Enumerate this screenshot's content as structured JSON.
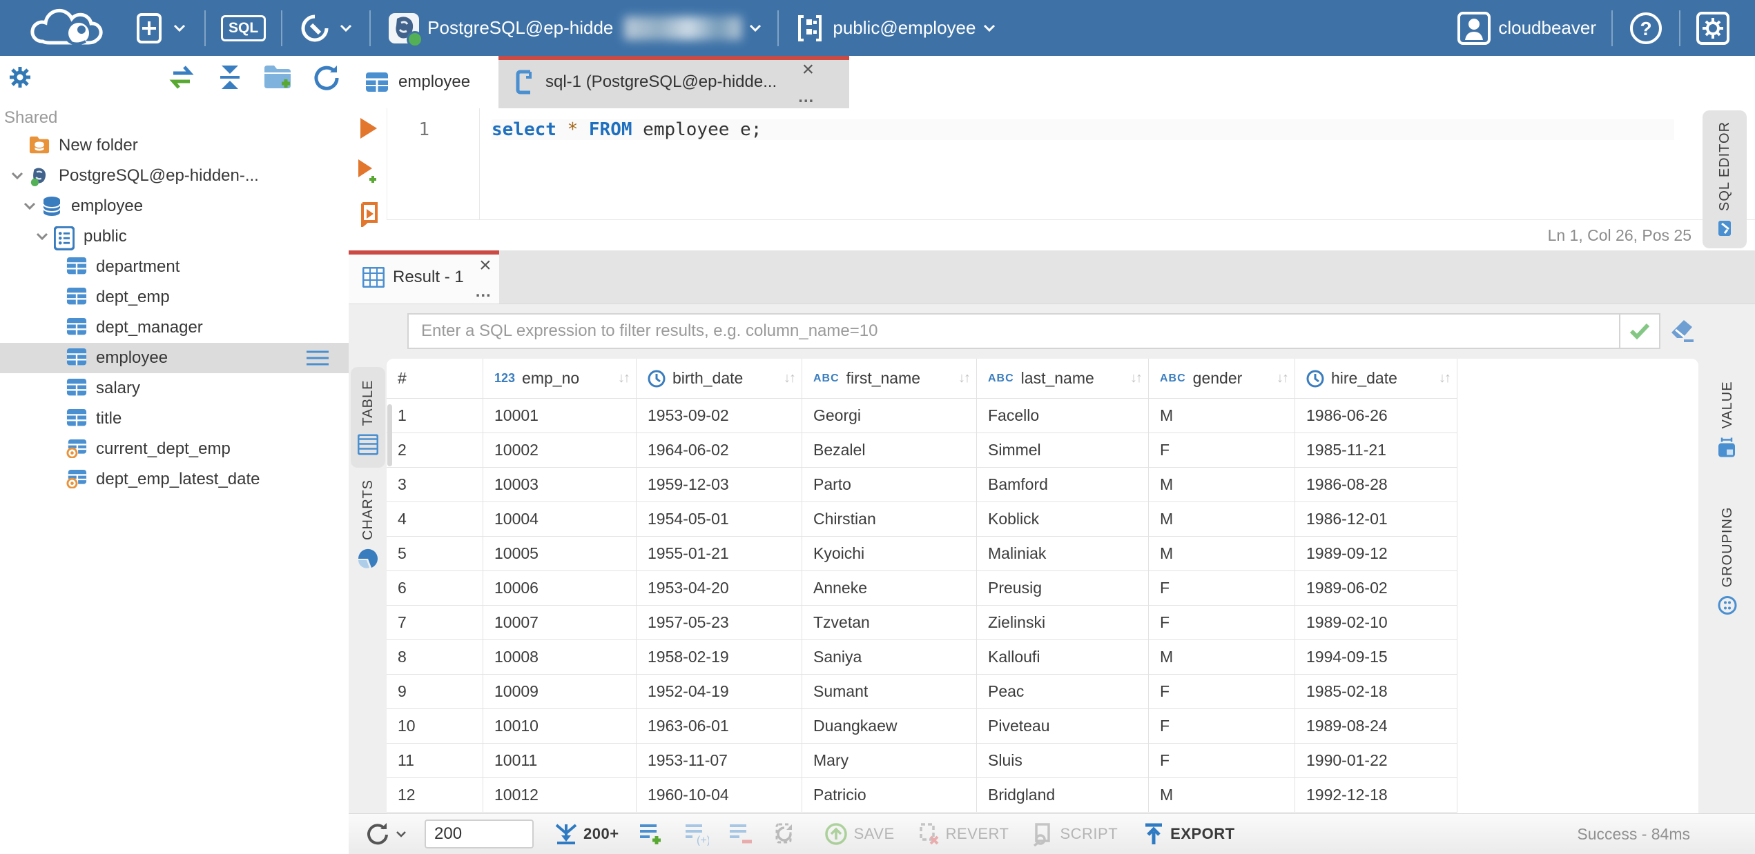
{
  "topbar": {
    "sql_button": "SQL",
    "connection_label": "PostgreSQL@ep-hidde",
    "schema_label": "public@employee",
    "user_label": "cloudbeaver"
  },
  "sidebar": {
    "section_label": "Shared",
    "tree": [
      {
        "label": "New folder",
        "icon": "folder-db",
        "depth": 0,
        "chevron": false
      },
      {
        "label": "PostgreSQL@ep-hidden-...",
        "icon": "postgres",
        "depth": 0,
        "chevron": true
      },
      {
        "label": "employee",
        "icon": "database",
        "depth": 1,
        "chevron": true
      },
      {
        "label": "public",
        "icon": "schema",
        "depth": 2,
        "chevron": true
      },
      {
        "label": "department",
        "icon": "table",
        "depth": 3,
        "chevron": false
      },
      {
        "label": "dept_emp",
        "icon": "table",
        "depth": 3,
        "chevron": false
      },
      {
        "label": "dept_manager",
        "icon": "table",
        "depth": 3,
        "chevron": false
      },
      {
        "label": "employee",
        "icon": "table",
        "depth": 3,
        "chevron": false,
        "selected": true,
        "menu": true
      },
      {
        "label": "salary",
        "icon": "table",
        "depth": 3,
        "chevron": false
      },
      {
        "label": "title",
        "icon": "table",
        "depth": 3,
        "chevron": false
      },
      {
        "label": "current_dept_emp",
        "icon": "view",
        "depth": 3,
        "chevron": false
      },
      {
        "label": "dept_emp_latest_date",
        "icon": "view",
        "depth": 3,
        "chevron": false
      }
    ]
  },
  "editor": {
    "tabs": [
      {
        "label": "employee"
      },
      {
        "label": "sql-1 (PostgreSQL@ep-hidde..."
      }
    ],
    "line_number": "1",
    "sql_tokens": [
      {
        "text": "select",
        "type": "keyword"
      },
      {
        "text": " ",
        "type": "plain"
      },
      {
        "text": "*",
        "type": "star"
      },
      {
        "text": " ",
        "type": "plain"
      },
      {
        "text": "FROM",
        "type": "keyword"
      },
      {
        "text": " employee e;",
        "type": "plain"
      }
    ],
    "status": "Ln 1, Col 26, Pos 25",
    "right_tab_label": "SQL EDITOR"
  },
  "results": {
    "tab_label": "Result - 1",
    "filter_placeholder": "Enter a SQL expression to filter results, e.g. column_name=10",
    "left_tabs": [
      {
        "label": "TABLE",
        "active": true
      },
      {
        "label": "CHARTS",
        "active": false
      }
    ],
    "right_tabs": [
      {
        "label": "VALUE"
      },
      {
        "label": "GROUPING"
      }
    ],
    "grid": {
      "row_header": "#",
      "sort_glyph": "↓↑",
      "columns": [
        {
          "name": "emp_no",
          "type": "number"
        },
        {
          "name": "birth_date",
          "type": "datetime"
        },
        {
          "name": "first_name",
          "type": "text"
        },
        {
          "name": "last_name",
          "type": "text"
        },
        {
          "name": "gender",
          "type": "text"
        },
        {
          "name": "hire_date",
          "type": "datetime"
        }
      ],
      "rows": [
        [
          "1",
          "10001",
          "1953-09-02",
          "Georgi",
          "Facello",
          "M",
          "1986-06-26"
        ],
        [
          "2",
          "10002",
          "1964-06-02",
          "Bezalel",
          "Simmel",
          "F",
          "1985-11-21"
        ],
        [
          "3",
          "10003",
          "1959-12-03",
          "Parto",
          "Bamford",
          "M",
          "1986-08-28"
        ],
        [
          "4",
          "10004",
          "1954-05-01",
          "Chirstian",
          "Koblick",
          "M",
          "1986-12-01"
        ],
        [
          "5",
          "10005",
          "1955-01-21",
          "Kyoichi",
          "Maliniak",
          "M",
          "1989-09-12"
        ],
        [
          "6",
          "10006",
          "1953-04-20",
          "Anneke",
          "Preusig",
          "F",
          "1989-06-02"
        ],
        [
          "7",
          "10007",
          "1957-05-23",
          "Tzvetan",
          "Zielinski",
          "F",
          "1989-02-10"
        ],
        [
          "8",
          "10008",
          "1958-02-19",
          "Saniya",
          "Kalloufi",
          "M",
          "1994-09-15"
        ],
        [
          "9",
          "10009",
          "1952-04-19",
          "Sumant",
          "Peac",
          "F",
          "1985-02-18"
        ],
        [
          "10",
          "10010",
          "1963-06-01",
          "Duangkaew",
          "Piveteau",
          "F",
          "1989-08-24"
        ],
        [
          "11",
          "10011",
          "1953-11-07",
          "Mary",
          "Sluis",
          "F",
          "1990-01-22"
        ],
        [
          "12",
          "10012",
          "1960-10-04",
          "Patricio",
          "Bridgland",
          "M",
          "1992-12-18"
        ]
      ]
    },
    "toolbar": {
      "fetch_size": "200",
      "fetch_more_label": "200+",
      "save_label": "SAVE",
      "revert_label": "REVERT",
      "script_label": "SCRIPT",
      "export_label": "EXPORT",
      "status": "Success - 84ms"
    }
  }
}
